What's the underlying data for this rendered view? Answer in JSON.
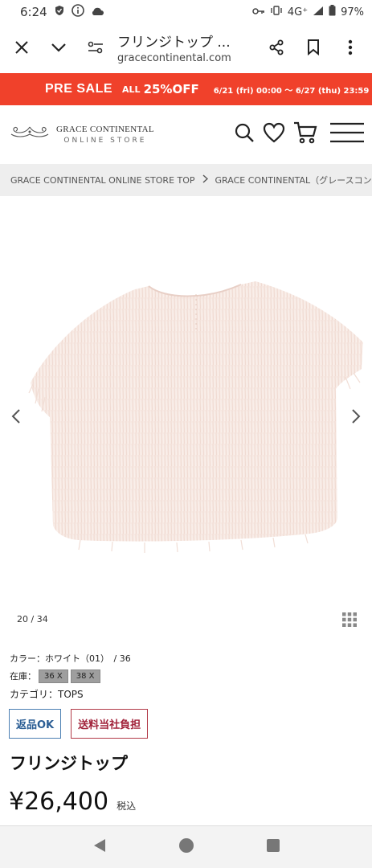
{
  "status_bar": {
    "time": "6:24",
    "network": "4G⁺",
    "battery": "97%"
  },
  "browser": {
    "title": "フリンジトップ ...",
    "url": "gracecontinental.com"
  },
  "sale_banner": {
    "pre_sale": "PRE SALE",
    "all": "ALL",
    "percent": "25%OFF",
    "dates": "6/21 (fri) 00:00 ～ 6/27 (thu) 23:59",
    "color": "#f0412b"
  },
  "header": {
    "logo_name": "GRACE CONTINENTAL",
    "logo_sub": "ONLINE STORE"
  },
  "breadcrumb": {
    "items": [
      "GRACE CONTINENTAL ONLINE STORE TOP",
      "GRACE CONTINENTAL（グレースコンチネンタル）"
    ]
  },
  "gallery": {
    "counter": "20 / 34"
  },
  "product": {
    "color_line": "カラー：ホワイト（01）　/ 36",
    "stock_label": "在庫：",
    "stock_sizes": [
      "36 X",
      "38 X"
    ],
    "category": "カテゴリ：TOPS",
    "tags": [
      "返品OK",
      "送料当社負担"
    ],
    "name": "フリンジトップ",
    "price": "¥26,400",
    "tax": "税込"
  }
}
